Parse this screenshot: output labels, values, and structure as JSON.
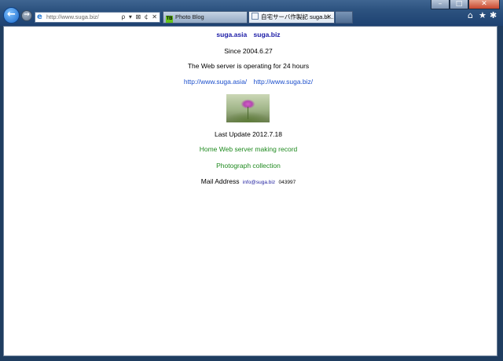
{
  "browser": {
    "address_url": "http://www.suga.biz/",
    "address_icons": "ρ ▾ ⊠ ¢ ✕",
    "tabs": [
      {
        "label": "Photo Blog",
        "active": false,
        "favicon_text": "TB"
      },
      {
        "label": "自宅サーバ作製記 suga.bi...",
        "active": true,
        "close": "✕"
      }
    ],
    "window_buttons": [
      "–",
      "□",
      "✕"
    ],
    "back_glyph": "←",
    "forward_glyph": "→",
    "toolbar_icons": {
      "home": "⌂",
      "favorites": "★",
      "tools": "✱"
    }
  },
  "page": {
    "domain_links": [
      "suga.asia",
      "suga.biz"
    ],
    "since": "Since 2004.6.27",
    "operating": "The Web server is operating for 24 hours",
    "url_links": [
      "http://www.suga.asia/",
      "http://www.suga.biz/"
    ],
    "photo_alt": "flower-photo",
    "last_update": "Last Update 2012.7.18",
    "record_link": "Home Web server making record",
    "photograph_link": "Photograph collection",
    "mail_label": "Mail Address",
    "mail_link": "info@suga.biz",
    "counter": "043997"
  },
  "colors": {
    "link_blue": "#1a1aa6",
    "url_blue": "#1c4fcc",
    "link_green": "#1f8a1f",
    "frame": "#2c527f"
  }
}
